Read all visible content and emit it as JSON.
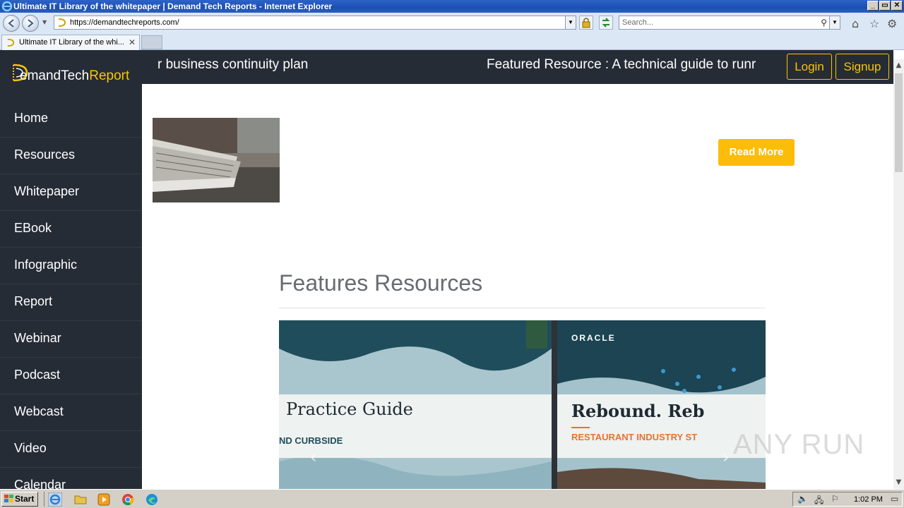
{
  "window": {
    "title": "Ultimate IT Library of the whitepaper | Demand Tech Reports - Internet Explorer",
    "buttons": [
      "_",
      "▭",
      "✕"
    ]
  },
  "browser": {
    "url": "https://demandtechreports.com/",
    "search_placeholder": "Search...",
    "tab_label": "Ultimate IT Library of the whi...",
    "tab_close": "✕"
  },
  "site": {
    "brand_part1": "emandTech",
    "brand_part2": "Report",
    "nav": [
      "Home",
      "Resources",
      "Whitepaper",
      "EBook",
      "Infographic",
      "Report",
      "Webinar",
      "Podcast",
      "Webcast",
      "Video",
      "Calendar"
    ],
    "ticker_left": "r business continuity plan",
    "ticker_right": "Featured Resource : A technical guide to runr",
    "login": "Login",
    "signup": "Signup",
    "read_more": "Read More",
    "features_title": "Features Resources",
    "card1_title": "Practice Guide",
    "card1_sub": "ND CURBSIDE",
    "card2_brand": "ORACLE",
    "card2_title": "Rebound. Reb",
    "card2_sub": "RESTAURANT INDUSTRY ST",
    "watermark": "ANY RUN"
  },
  "taskbar": {
    "start": "Start",
    "clock": "1:02 PM"
  },
  "colors": {
    "accent_yellow": "#fbbd08",
    "sidebar_bg": "#262c36",
    "titlebar_blue": "#1b4fb4"
  }
}
